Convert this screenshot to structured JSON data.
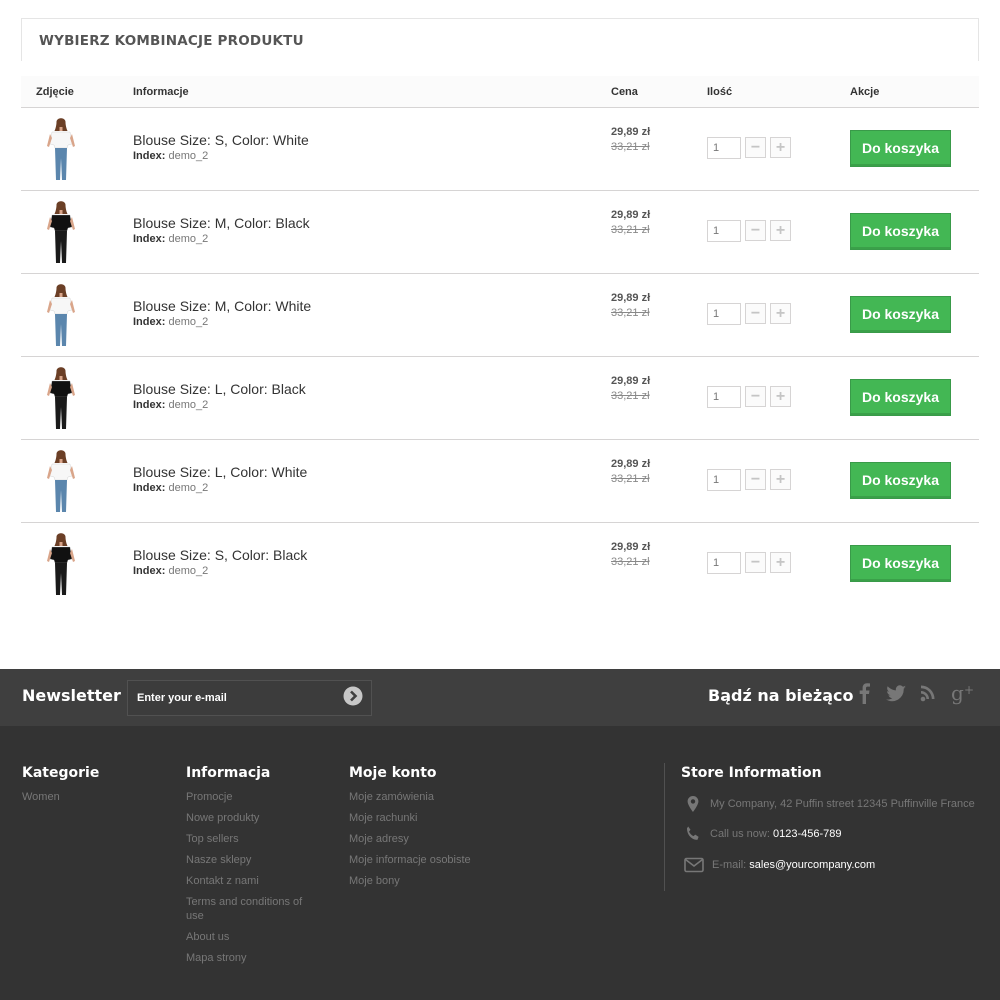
{
  "combinations": {
    "title": "WYBIERZ KOMBINACJE PRODUKTU",
    "columns": {
      "photo": "Zdjęcie",
      "info": "Informacje",
      "price": "Cena",
      "qty": "Ilość",
      "actions": "Akcje"
    },
    "index_label": "Index:",
    "rows": [
      {
        "name": "Blouse Size: S, Color: White",
        "index": "demo_2",
        "price": "29,89 zł",
        "old_price": "33,21 zł",
        "qty": "1",
        "button": "Do koszyka",
        "shirt_color": "white"
      },
      {
        "name": "Blouse Size: M, Color: Black",
        "index": "demo_2",
        "price": "29,89 zł",
        "old_price": "33,21 zł",
        "qty": "1",
        "button": "Do koszyka",
        "shirt_color": "black"
      },
      {
        "name": "Blouse Size: M, Color: White",
        "index": "demo_2",
        "price": "29,89 zł",
        "old_price": "33,21 zł",
        "qty": "1",
        "button": "Do koszyka",
        "shirt_color": "white"
      },
      {
        "name": "Blouse Size: L, Color: Black",
        "index": "demo_2",
        "price": "29,89 zł",
        "old_price": "33,21 zł",
        "qty": "1",
        "button": "Do koszyka",
        "shirt_color": "black"
      },
      {
        "name": "Blouse Size: L, Color: White",
        "index": "demo_2",
        "price": "29,89 zł",
        "old_price": "33,21 zł",
        "qty": "1",
        "button": "Do koszyka",
        "shirt_color": "white"
      },
      {
        "name": "Blouse Size: S, Color: Black",
        "index": "demo_2",
        "price": "29,89 zł",
        "old_price": "33,21 zł",
        "qty": "1",
        "button": "Do koszyka",
        "shirt_color": "black"
      }
    ]
  },
  "newsletter": {
    "title": "Newsletter",
    "placeholder": "Enter your e-mail",
    "submit_icon": "chevron-right-circle-icon"
  },
  "social": {
    "title": "Bądź na bieżąco",
    "icons": [
      "facebook-icon",
      "twitter-icon",
      "rss-icon",
      "google-plus-icon"
    ]
  },
  "footer": {
    "categories": {
      "title": "Kategorie",
      "items": [
        "Women"
      ]
    },
    "information": {
      "title": "Informacja",
      "items": [
        "Promocje",
        "Nowe produkty",
        "Top sellers",
        "Nasze sklepy",
        "Kontakt z nami",
        "Terms and conditions of use",
        "About us",
        "Mapa strony"
      ]
    },
    "account": {
      "title": "Moje konto",
      "items": [
        "Moje zamówienia",
        "Moje rachunki",
        "Moje adresy",
        "Moje informacje osobiste",
        "Moje bony"
      ]
    },
    "store": {
      "title": "Store Information",
      "address": "My Company, 42 Puffin street 12345 Puffinville France",
      "phone_label": "Call us now:",
      "phone": "0123-456-789",
      "email_label": "E-mail:",
      "email": "sales@yourcompany.com"
    }
  },
  "colors": {
    "cart_button": "#43b754",
    "newsletter_bg": "#3f3f3f",
    "footer_bg": "#333333"
  }
}
